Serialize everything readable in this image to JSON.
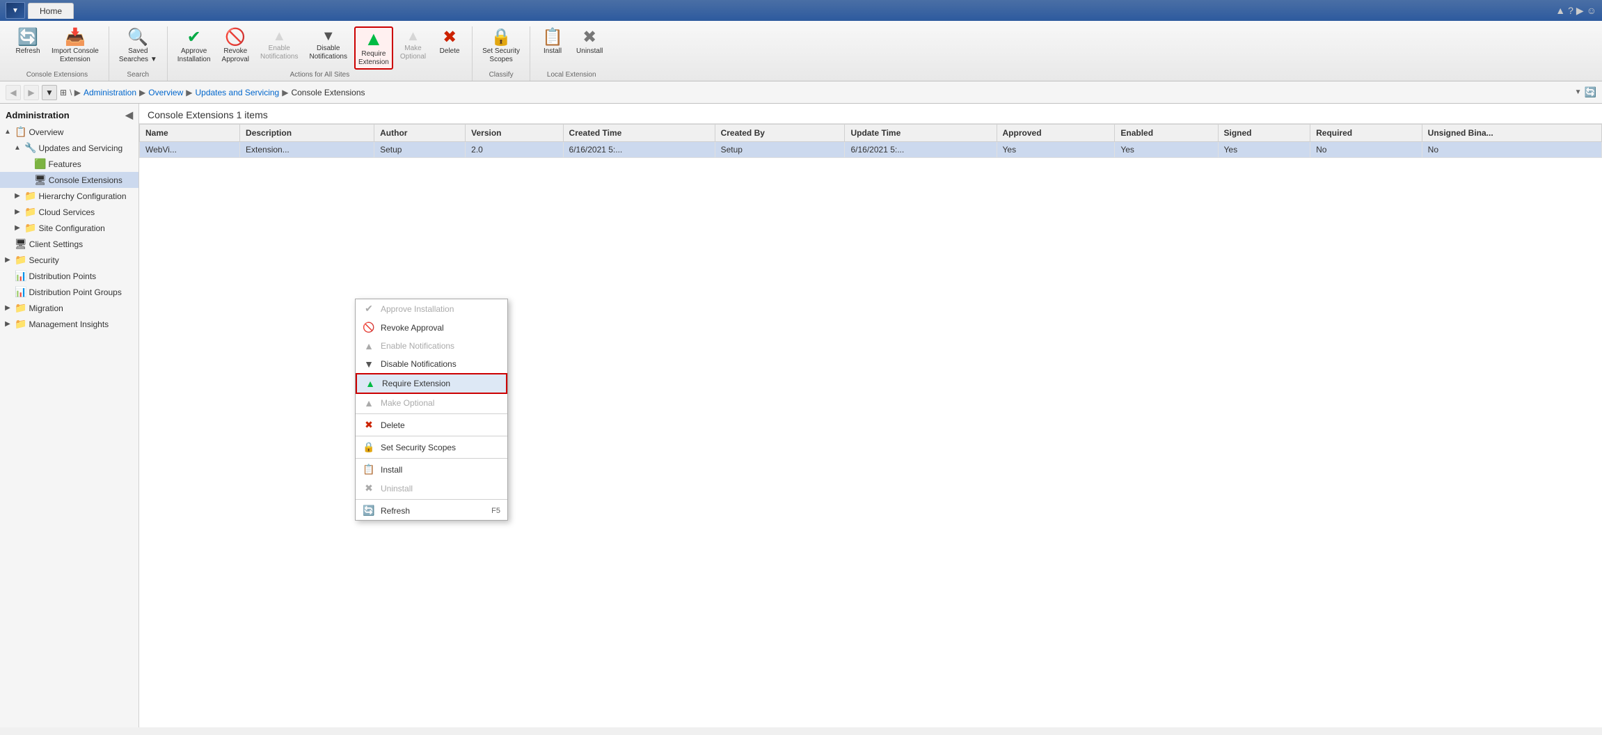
{
  "titlebar": {
    "tab": "Home",
    "controls": [
      "▲",
      "?",
      "▶",
      "☺"
    ]
  },
  "ribbon": {
    "groups": [
      {
        "label": "Console Extensions",
        "items": [
          {
            "id": "refresh",
            "label": "Refresh",
            "icon": "🔄",
            "disabled": false,
            "highlighted": false
          },
          {
            "id": "import-console",
            "label": "Import Console\nExtension",
            "icon": "📥",
            "disabled": false,
            "highlighted": false
          }
        ]
      },
      {
        "label": "Search",
        "items": [
          {
            "id": "saved-searches",
            "label": "Saved\nSearches",
            "icon": "🔍",
            "disabled": false,
            "highlighted": false,
            "dropdown": true
          }
        ]
      },
      {
        "label": "Actions for All Sites",
        "items": [
          {
            "id": "approve-installation",
            "label": "Approve\nInstallation",
            "icon": "✔",
            "disabled": false,
            "highlighted": false,
            "color": "green"
          },
          {
            "id": "revoke-approval",
            "label": "Revoke\nApproval",
            "icon": "🚫",
            "disabled": false,
            "highlighted": false
          },
          {
            "id": "enable-notifications",
            "label": "Enable\nNotifications",
            "icon": "⬆",
            "disabled": true,
            "highlighted": false,
            "color": "green"
          },
          {
            "id": "disable-notifications",
            "label": "Disable\nNotifications",
            "icon": "⬇",
            "disabled": false,
            "highlighted": false
          },
          {
            "id": "require-extension",
            "label": "Require\nExtension",
            "icon": "⬆",
            "disabled": false,
            "highlighted": true,
            "color": "green"
          },
          {
            "id": "make-optional",
            "label": "Make\nOptional",
            "icon": "⬆",
            "disabled": true,
            "highlighted": false
          },
          {
            "id": "delete",
            "label": "Delete",
            "icon": "✖",
            "disabled": false,
            "highlighted": false,
            "color": "red"
          }
        ]
      },
      {
        "label": "Classify",
        "items": [
          {
            "id": "set-security-scopes",
            "label": "Set Security\nScopes",
            "icon": "🔒",
            "disabled": false,
            "highlighted": false
          }
        ]
      },
      {
        "label": "Local Extension",
        "items": [
          {
            "id": "install",
            "label": "Install",
            "icon": "📋",
            "disabled": false,
            "highlighted": false
          },
          {
            "id": "uninstall",
            "label": "Uninstall",
            "icon": "✖",
            "disabled": false,
            "highlighted": false,
            "color": "gray"
          }
        ]
      }
    ]
  },
  "breadcrumb": {
    "parts": [
      "Administration",
      "Overview",
      "Updates and Servicing",
      "Console Extensions"
    ]
  },
  "sidebar": {
    "title": "Administration",
    "tree": [
      {
        "level": 0,
        "id": "overview",
        "label": "Overview",
        "icon": "📋",
        "toggle": "▲",
        "expanded": true
      },
      {
        "level": 1,
        "id": "updates-servicing",
        "label": "Updates and Servicing",
        "icon": "🔧",
        "toggle": "▲",
        "expanded": true
      },
      {
        "level": 2,
        "id": "features",
        "label": "Features",
        "icon": "🟩",
        "toggle": ""
      },
      {
        "level": 2,
        "id": "console-extensions",
        "label": "Console Extensions",
        "icon": "🖥",
        "toggle": "",
        "selected": true
      },
      {
        "level": 1,
        "id": "hierarchy-config",
        "label": "Hierarchy Configuration",
        "icon": "📁",
        "toggle": "▶",
        "expanded": false
      },
      {
        "level": 1,
        "id": "cloud-services",
        "label": "Cloud Services",
        "icon": "📁",
        "toggle": "▶",
        "expanded": false
      },
      {
        "level": 1,
        "id": "site-config",
        "label": "Site Configuration",
        "icon": "📁",
        "toggle": "▶",
        "expanded": false
      },
      {
        "level": 0,
        "id": "client-settings",
        "label": "Client Settings",
        "icon": "🖥",
        "toggle": ""
      },
      {
        "level": 0,
        "id": "security",
        "label": "Security",
        "icon": "📁",
        "toggle": "▶",
        "expanded": false
      },
      {
        "level": 0,
        "id": "distribution-points",
        "label": "Distribution Points",
        "icon": "📊",
        "toggle": ""
      },
      {
        "level": 0,
        "id": "distribution-point-groups",
        "label": "Distribution Point Groups",
        "icon": "📊",
        "toggle": ""
      },
      {
        "level": 0,
        "id": "migration",
        "label": "Migration",
        "icon": "📁",
        "toggle": "▶",
        "expanded": false
      },
      {
        "level": 0,
        "id": "management-insights",
        "label": "Management Insights",
        "icon": "📁",
        "toggle": "▶",
        "expanded": false
      }
    ]
  },
  "content": {
    "title": "Console Extensions 1 items",
    "columns": [
      "Name",
      "Description",
      "Author",
      "Version",
      "Created Time",
      "Created By",
      "Update Time",
      "Approved",
      "Enabled",
      "Signed",
      "Required",
      "Unsigned Bina..."
    ],
    "rows": [
      {
        "name": "WebVi...",
        "description": "Extension...",
        "author": "Setup",
        "version": "2.0",
        "created_time": "6/16/2021 5:...",
        "created_by": "Setup",
        "update_time": "6/16/2021 5:...",
        "approved": "Yes",
        "enabled": "Yes",
        "signed": "Yes",
        "required": "No",
        "unsigned_binary": "No"
      }
    ]
  },
  "context_menu": {
    "items": [
      {
        "id": "ctx-approve",
        "label": "Approve Installation",
        "icon": "✔",
        "disabled": true,
        "separator_after": false,
        "color": "green",
        "shortcut": ""
      },
      {
        "id": "ctx-revoke",
        "label": "Revoke Approval",
        "icon": "🚫",
        "disabled": false,
        "separator_after": false,
        "color": "red",
        "shortcut": ""
      },
      {
        "id": "ctx-enable-notify",
        "label": "Enable Notifications",
        "icon": "⬆",
        "disabled": true,
        "separator_after": false,
        "color": "gray",
        "shortcut": ""
      },
      {
        "id": "ctx-disable-notify",
        "label": "Disable Notifications",
        "icon": "⬇",
        "disabled": false,
        "separator_after": false,
        "color": "dark",
        "shortcut": ""
      },
      {
        "id": "ctx-require",
        "label": "Require Extension",
        "icon": "⬆",
        "disabled": false,
        "separator_after": false,
        "color": "green",
        "highlighted": true,
        "shortcut": ""
      },
      {
        "id": "ctx-optional",
        "label": "Make Optional",
        "icon": "⬆",
        "disabled": true,
        "separator_after": true,
        "color": "gray",
        "shortcut": ""
      },
      {
        "id": "ctx-delete",
        "label": "Delete",
        "icon": "✖",
        "disabled": false,
        "separator_after": true,
        "color": "red",
        "shortcut": ""
      },
      {
        "id": "ctx-security",
        "label": "Set Security Scopes",
        "icon": "🔒",
        "disabled": false,
        "separator_after": true,
        "color": "dark",
        "shortcut": ""
      },
      {
        "id": "ctx-install",
        "label": "Install",
        "icon": "📋",
        "disabled": false,
        "separator_after": false,
        "color": "dark",
        "shortcut": ""
      },
      {
        "id": "ctx-uninstall",
        "label": "Uninstall",
        "icon": "✖",
        "disabled": true,
        "separator_after": true,
        "color": "gray",
        "shortcut": ""
      },
      {
        "id": "ctx-refresh",
        "label": "Refresh",
        "icon": "🔄",
        "disabled": false,
        "separator_after": false,
        "color": "green",
        "shortcut": "F5"
      }
    ]
  }
}
